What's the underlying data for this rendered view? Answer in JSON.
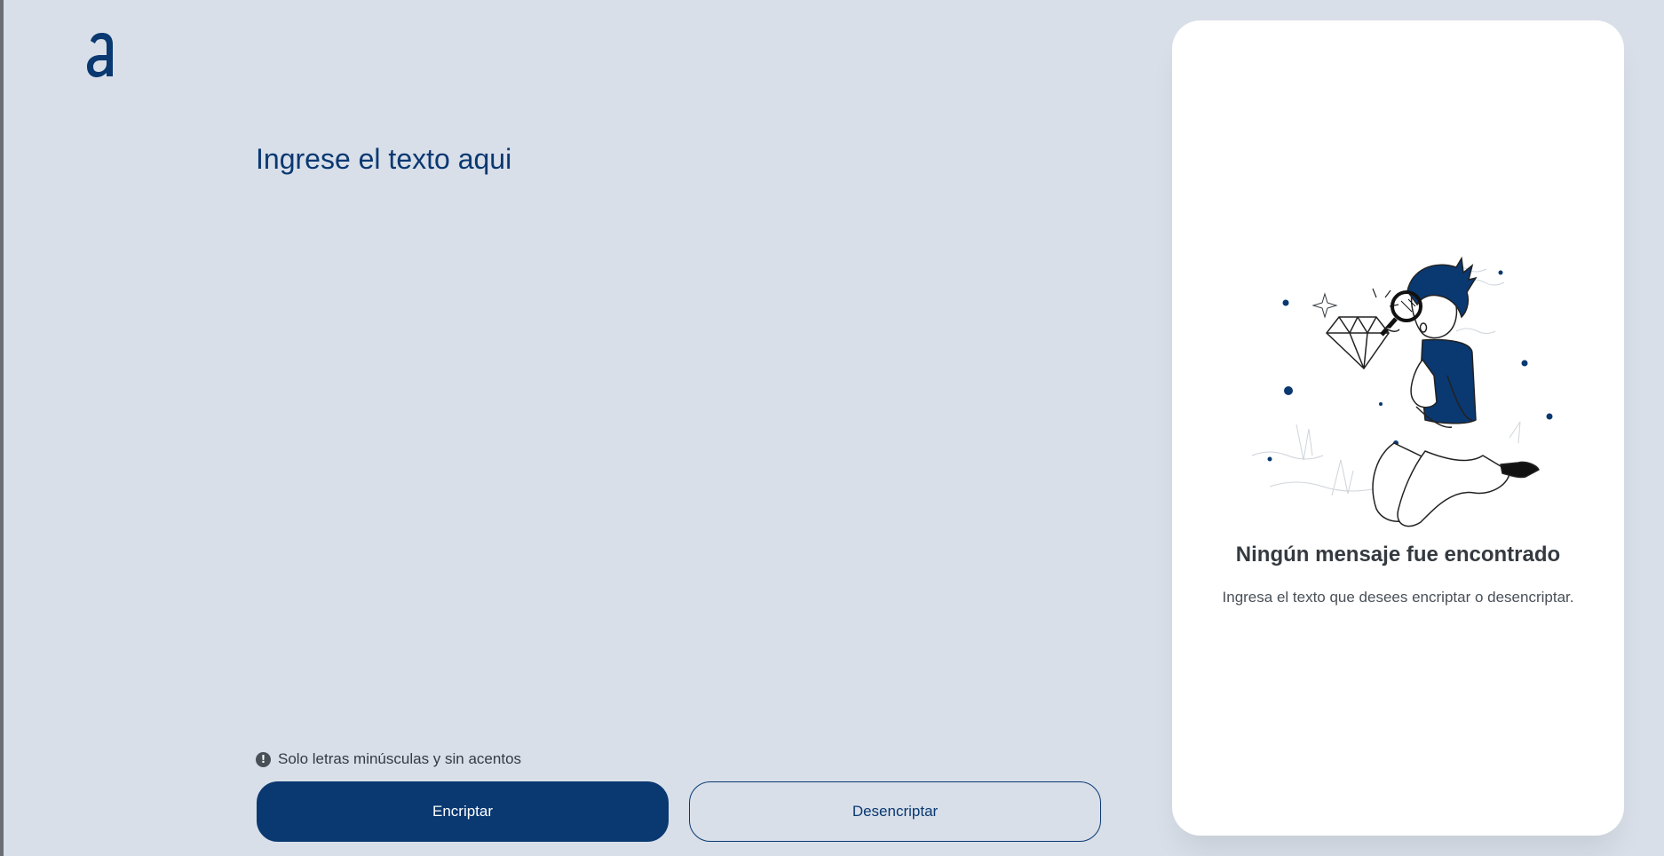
{
  "app": {
    "logo_icon": "alura-a-logo-icon",
    "accent_color": "#0a3871",
    "background_color": "#d8dfe9"
  },
  "input": {
    "placeholder": "Ingrese el texto aqui",
    "value": ""
  },
  "hint": {
    "icon": "info-exclamation-icon",
    "text": "Solo letras minúsculas y sin acentos"
  },
  "buttons": {
    "encrypt_label": "Encriptar",
    "decrypt_label": "Desencriptar"
  },
  "output": {
    "illustration": "boy-with-magnifying-glass-diamond-illustration",
    "title": "Ningún mensaje fue encontrado",
    "subtitle": "Ingresa el texto que desees encriptar o desencriptar."
  }
}
